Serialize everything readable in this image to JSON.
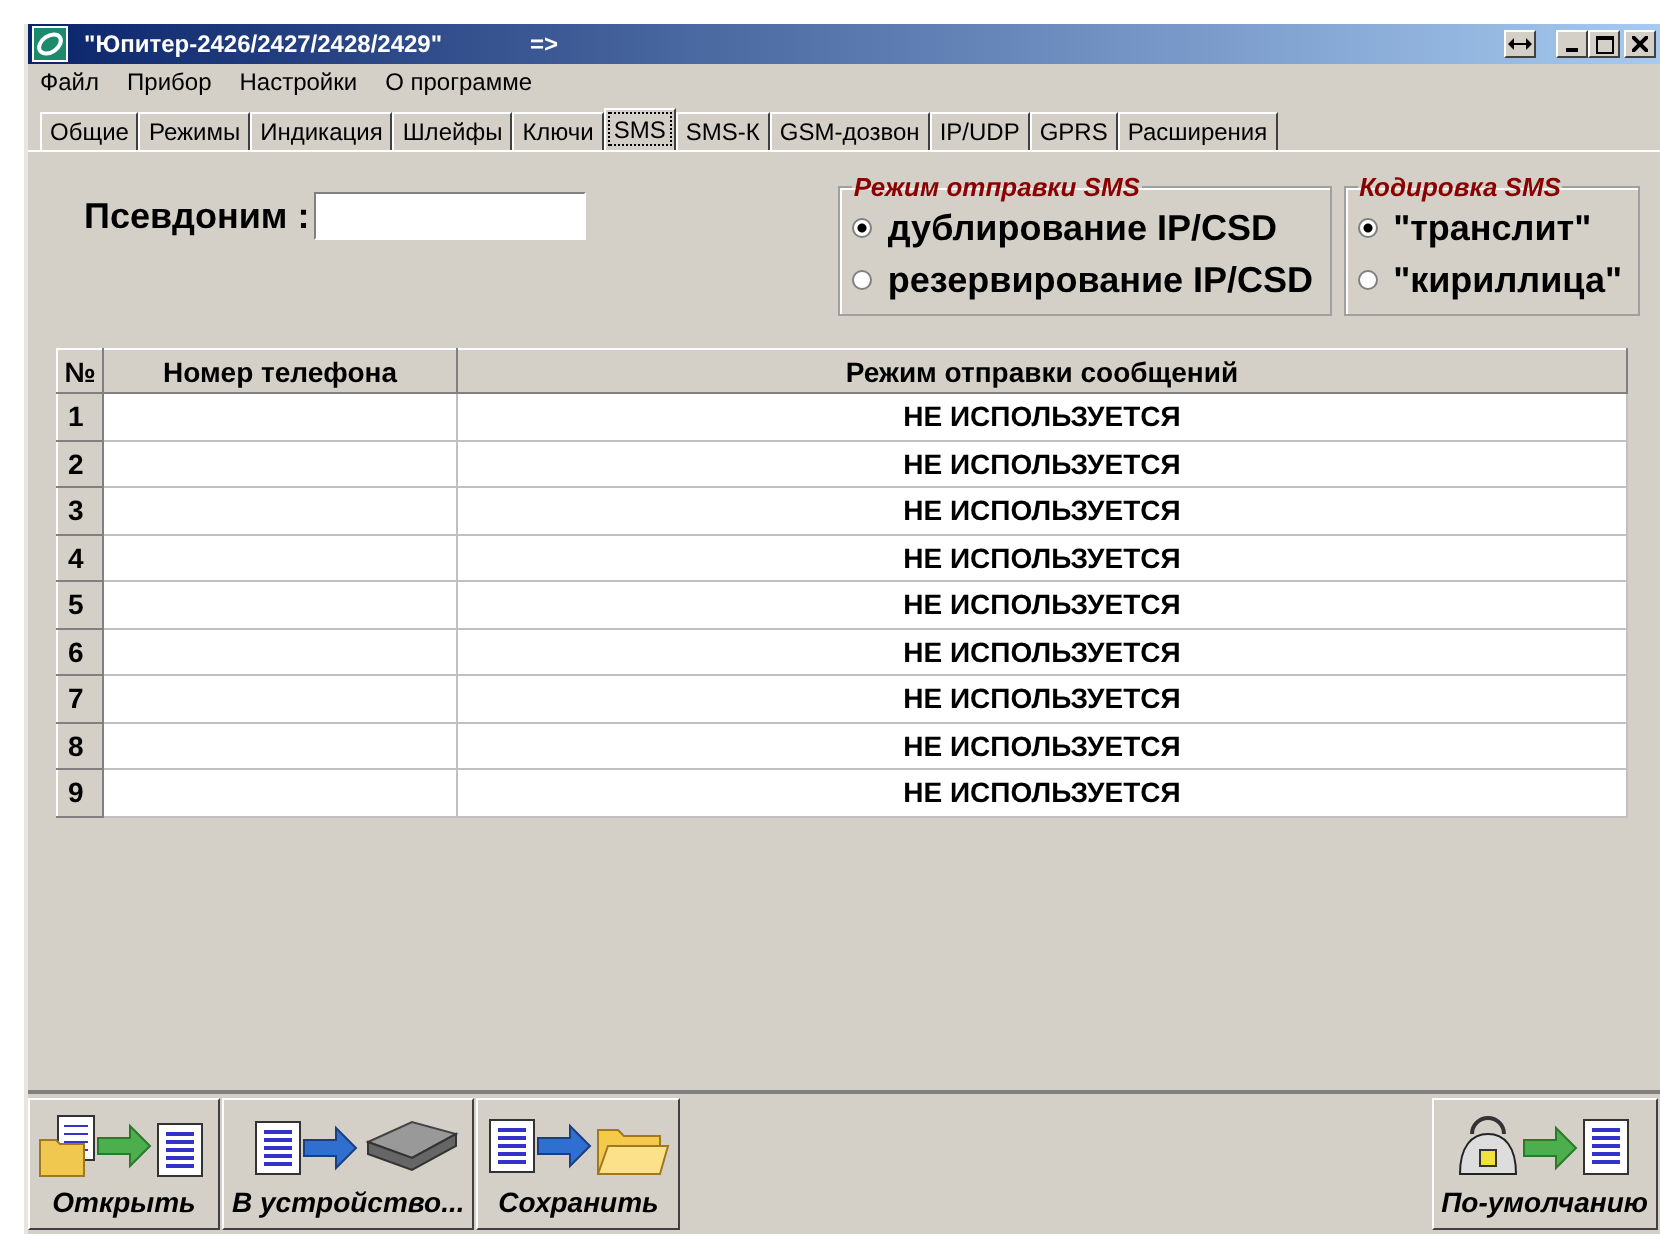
{
  "window": {
    "title": "\"Юпитер-2426/2427/2428/2429\"",
    "title_suffix": "=>"
  },
  "menu": [
    "Файл",
    "Прибор",
    "Настройки",
    "О программе"
  ],
  "tabs": [
    {
      "label": "Общие",
      "selected": false
    },
    {
      "label": "Режимы",
      "selected": false
    },
    {
      "label": "Индикация",
      "selected": false
    },
    {
      "label": "Шлейфы",
      "selected": false
    },
    {
      "label": "Ключи",
      "selected": false
    },
    {
      "label": "SMS",
      "selected": true
    },
    {
      "label": "SMS-К",
      "selected": false
    },
    {
      "label": "GSM-дозвон",
      "selected": false
    },
    {
      "label": "IP/UDP",
      "selected": false
    },
    {
      "label": "GPRS",
      "selected": false
    },
    {
      "label": "Расширения",
      "selected": false
    }
  ],
  "alias": {
    "label": "Псевдоним :"
  },
  "send_mode": {
    "title": "Режим отправки SMS",
    "options": [
      {
        "label": "дублирование IP/CSD",
        "selected": true
      },
      {
        "label": "резервирование IP/CSD",
        "selected": false
      }
    ]
  },
  "encoding": {
    "title": "Кодировка SMS",
    "options": [
      {
        "label": "\"транслит\"",
        "selected": true
      },
      {
        "label": "\"кириллица\"",
        "selected": false
      }
    ]
  },
  "table": {
    "columns": [
      "№",
      "Номер телефона",
      "Режим отправки сообщений"
    ],
    "rows": [
      {
        "number": "1",
        "mode": "НЕ ИСПОЛЬЗУЕТСЯ"
      },
      {
        "number": "2",
        "mode": "НЕ ИСПОЛЬЗУЕТСЯ"
      },
      {
        "number": "3",
        "mode": "НЕ ИСПОЛЬЗУЕТСЯ"
      },
      {
        "number": "4",
        "mode": "НЕ ИСПОЛЬЗУЕТСЯ"
      },
      {
        "number": "5",
        "mode": "НЕ ИСПОЛЬЗУЕТСЯ"
      },
      {
        "number": "6",
        "mode": "НЕ ИСПОЛЬЗУЕТСЯ"
      },
      {
        "number": "7",
        "mode": "НЕ ИСПОЛЬЗУЕТСЯ"
      },
      {
        "number": "8",
        "mode": "НЕ ИСПОЛЬЗУЕТСЯ"
      },
      {
        "number": "9",
        "mode": "НЕ ИСПОЛЬЗУЕТСЯ"
      }
    ]
  },
  "toolbar_left": [
    {
      "label": "Открыть",
      "kind": "open"
    },
    {
      "label": "В устройство...",
      "kind": "write"
    },
    {
      "label": "Сохранить",
      "kind": "save"
    }
  ],
  "toolbar_right": [
    {
      "label": "По-умолчанию",
      "kind": "defaults"
    }
  ]
}
